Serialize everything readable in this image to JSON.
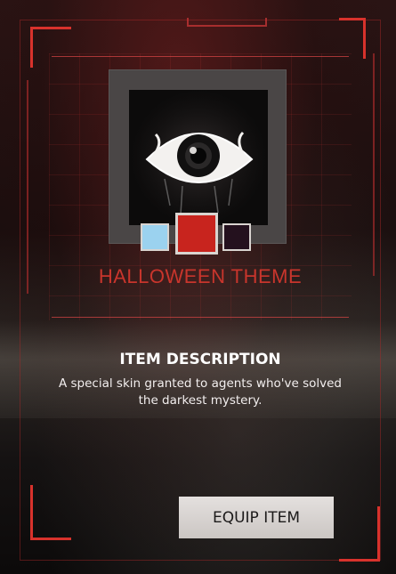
{
  "item": {
    "name": "HALLOWEEN THEME",
    "image_icon": "eye-icon",
    "color_swatches": [
      {
        "name": "light-blue",
        "color": "#9bd2ef"
      },
      {
        "name": "red",
        "color": "#c8241e",
        "selected": true
      },
      {
        "name": "dark-purple",
        "color": "#24111e"
      }
    ]
  },
  "description": {
    "title": "ITEM DESCRIPTION",
    "text": "A special skin granted to agents who've solved the darkest mystery."
  },
  "actions": {
    "equip_label": "EQUIP ITEM"
  },
  "colors": {
    "accent": "#d8322c",
    "title_red": "#c8352c",
    "button_bg": "#d9d5d2"
  }
}
